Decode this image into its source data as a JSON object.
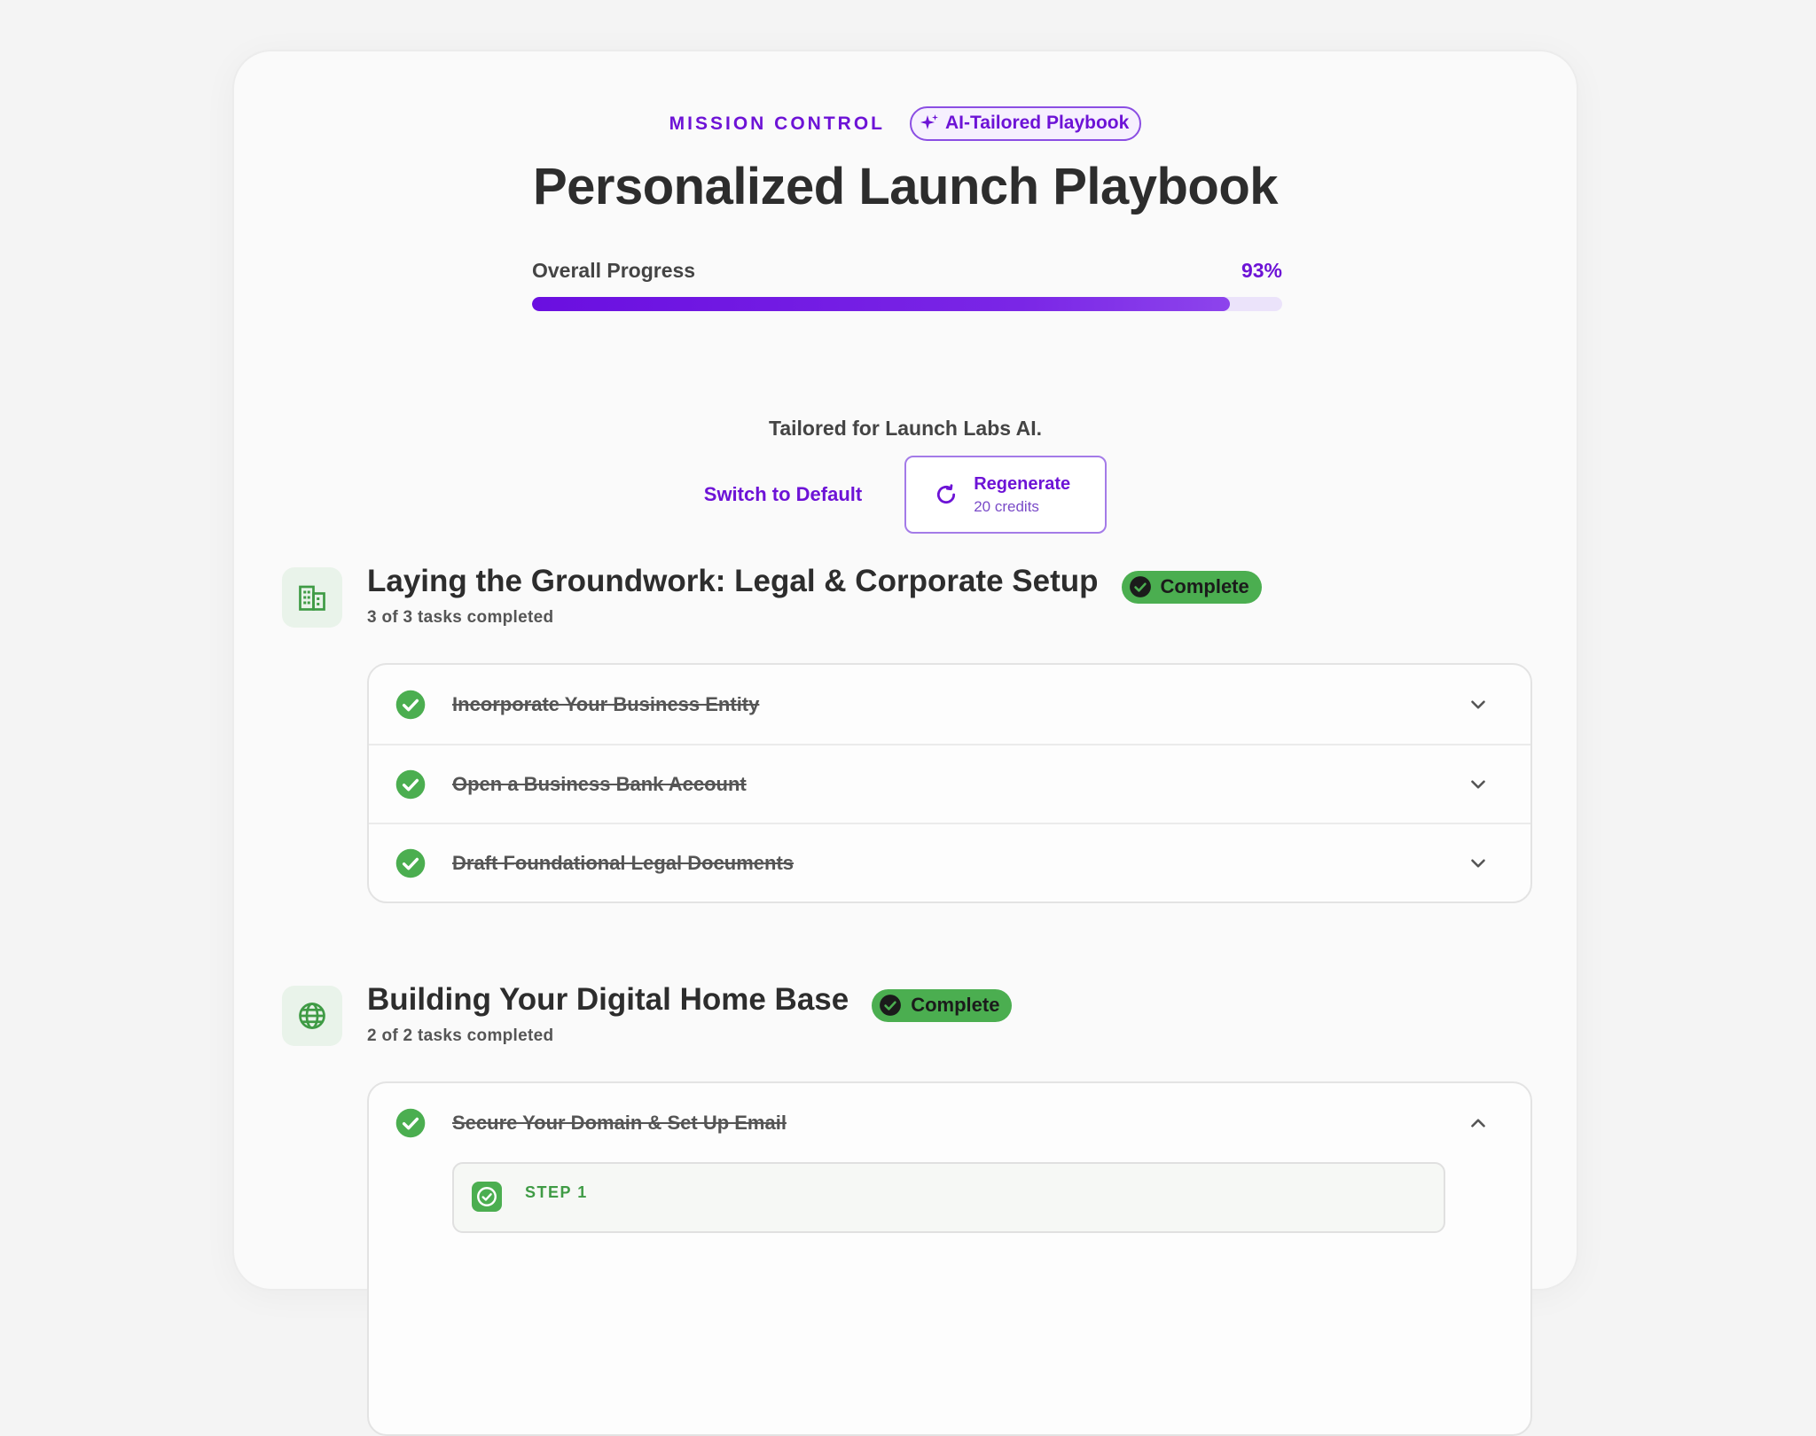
{
  "header": {
    "eyebrow": "MISSION CONTROL",
    "badge_label": "AI-Tailored Playbook",
    "title": "Personalized Launch Playbook"
  },
  "progress": {
    "label": "Overall Progress",
    "percent_label": "93%",
    "value": 0.93
  },
  "tailored_text": "Tailored for Launch Labs AI.",
  "actions": {
    "switch_label": "Switch to Default",
    "regenerate_label": "Regenerate",
    "regenerate_cost": "20 credits"
  },
  "sections": [
    {
      "title": "Laying the Groundwork: Legal & Corporate Setup",
      "status": "Complete",
      "subtitle": "3 of 3 tasks completed",
      "icon": "building-icon",
      "tasks": [
        {
          "label": "Incorporate Your Business Entity",
          "done": true,
          "expanded": false
        },
        {
          "label": "Open a Business Bank Account",
          "done": true,
          "expanded": false
        },
        {
          "label": "Draft Foundational Legal Documents",
          "done": true,
          "expanded": false
        }
      ]
    },
    {
      "title": "Building Your Digital Home Base",
      "status": "Complete",
      "subtitle": "2 of 2 tasks completed",
      "icon": "globe-icon",
      "tasks": [
        {
          "label": "Secure Your Domain & Set Up Email",
          "done": true,
          "expanded": true,
          "step_label": "STEP 1"
        }
      ]
    }
  ],
  "colors": {
    "accent": "#6d13d6",
    "success": "#4bae50"
  }
}
